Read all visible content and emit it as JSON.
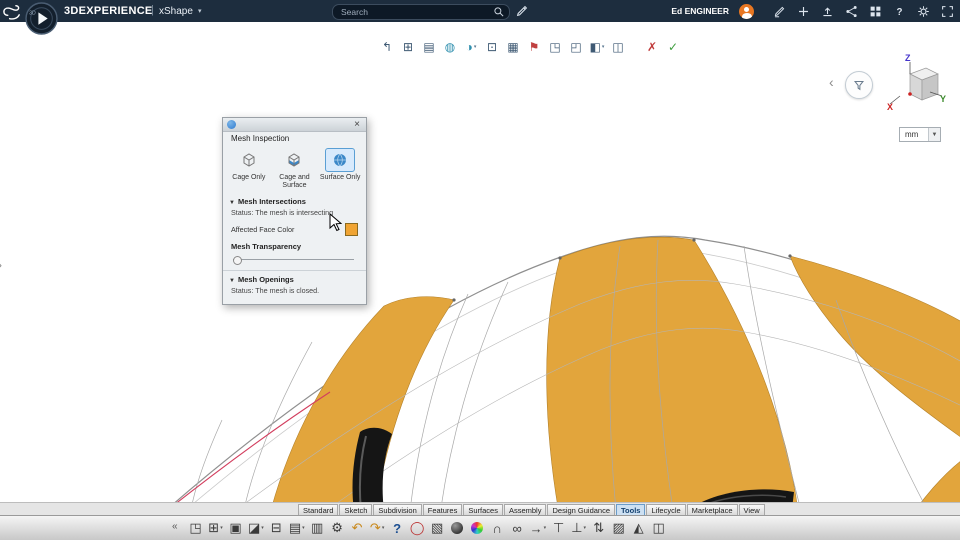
{
  "topbar": {
    "brand": "3DEXPERIENCE",
    "separator": "|",
    "app": "xShape",
    "search_placeholder": "Search",
    "user_name": "Ed ENGINEER"
  },
  "action_bar": {
    "icons": [
      {
        "name": "exit-app-icon",
        "glyph": "↰"
      },
      {
        "name": "update-model-icon",
        "glyph": "⊞"
      },
      {
        "name": "manage-views-icon",
        "glyph": "▤"
      },
      {
        "name": "sphere-mesh-icon",
        "glyph": "◍"
      },
      {
        "name": "sphere-options-icon",
        "glyph": "◑"
      },
      {
        "name": "bounding-box-icon",
        "glyph": "⊡"
      },
      {
        "name": "grid-display-icon",
        "glyph": "▦"
      },
      {
        "name": "flag-note-icon",
        "glyph": "⚑"
      },
      {
        "name": "plane-section-icon",
        "glyph": "◳"
      },
      {
        "name": "corner-trim-icon",
        "glyph": "◰"
      },
      {
        "name": "cube-options-icon",
        "glyph": "◧"
      },
      {
        "name": "measure-panel-icon",
        "glyph": "◫"
      },
      {
        "name": "mesh-check-error-icon",
        "glyph": "✗"
      },
      {
        "name": "mesh-check-ok-icon",
        "glyph": "✓"
      }
    ]
  },
  "viewport": {
    "units": "mm",
    "axis_x": "X",
    "axis_y": "Y",
    "axis_z": "Z",
    "axis_colors": {
      "x": "#cc2222",
      "y": "#3a8a2a",
      "z": "#4433cc"
    }
  },
  "dialog": {
    "title": "Mesh Inspection",
    "modes": [
      {
        "label": "Cage Only"
      },
      {
        "label": "Cage and Surface"
      },
      {
        "label": "Surface Only"
      }
    ],
    "selected_mode": "Surface Only",
    "intersections": {
      "header": "Mesh Intersections",
      "status": "Status: The mesh is intersecting",
      "color_label": "Affected Face Color",
      "color_value": "#f0a433",
      "transparency_label": "Mesh Transparency"
    },
    "openings": {
      "header": "Mesh Openings",
      "status": "Status: The mesh is closed."
    }
  },
  "tabs": {
    "items": [
      "Standard",
      "Sketch",
      "Subdivision",
      "Features",
      "Surfaces",
      "Assembly",
      "Design Guidance",
      "Tools",
      "Lifecycle",
      "Marketplace",
      "View"
    ],
    "active": "Tools"
  },
  "bottom_toolbar": {
    "collapse_glyph": "«",
    "icons": [
      {
        "name": "view-cube-icon",
        "glyph": "◳"
      },
      {
        "name": "new-content-icon",
        "glyph": "⊞"
      },
      {
        "name": "save-icon",
        "glyph": "▣"
      },
      {
        "name": "save-manage-icon",
        "glyph": "◪"
      },
      {
        "name": "import-export-icon",
        "glyph": "⊟"
      },
      {
        "name": "clipboard-paste-icon",
        "glyph": "▤"
      },
      {
        "name": "print-icon",
        "glyph": "▥"
      },
      {
        "name": "settings-gear-icon",
        "glyph": "⚙"
      },
      {
        "name": "undo-icon",
        "glyph": "↶"
      },
      {
        "name": "redo-icon",
        "glyph": "↷"
      },
      {
        "name": "help-icon",
        "glyph": "?"
      },
      {
        "name": "lasso-select-icon",
        "glyph": "◯"
      },
      {
        "name": "screenshot-icon",
        "glyph": "▧"
      },
      {
        "name": "material-sphere-icon",
        "glyph": "●"
      },
      {
        "name": "color-wheel-icon",
        "glyph": "●"
      },
      {
        "name": "snap-magnet-icon",
        "glyph": "∩"
      },
      {
        "name": "link-manage-icon",
        "glyph": "∞"
      },
      {
        "name": "pointer-tool-icon",
        "glyph": "→"
      },
      {
        "name": "measure-tool-icon",
        "glyph": "⊤"
      },
      {
        "name": "compass-align-icon",
        "glyph": "⊥"
      },
      {
        "name": "sort-order-icon",
        "glyph": "⇅"
      },
      {
        "name": "shading-mode-icon",
        "glyph": "▨"
      },
      {
        "name": "tree-structure-icon",
        "glyph": "◭"
      },
      {
        "name": "section-view-icon",
        "glyph": "◫"
      }
    ]
  },
  "model": {
    "color_orange": "#e2a53c",
    "color_intersection": "#d23e5e"
  }
}
